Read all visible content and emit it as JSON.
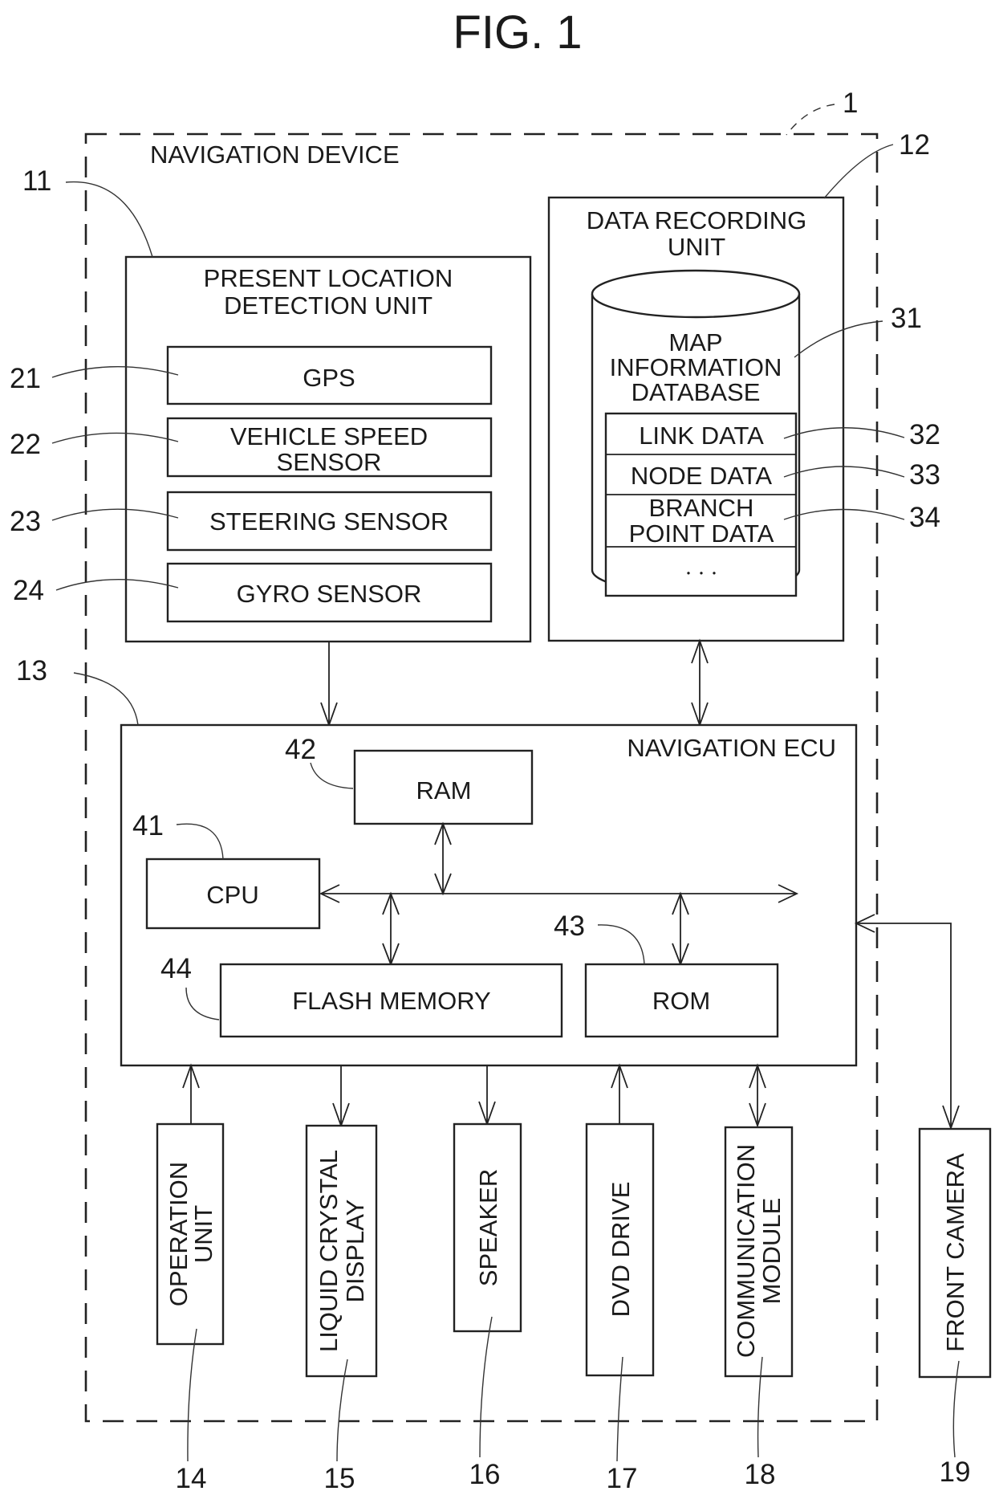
{
  "figure": {
    "title": "FIG. 1",
    "device_ref": "1",
    "device_label": "NAVIGATION DEVICE"
  },
  "present_location_unit": {
    "ref": "11",
    "title_line1": "PRESENT LOCATION",
    "title_line2": "DETECTION UNIT",
    "sensors": [
      {
        "ref": "21",
        "line1": "GPS",
        "line2": ""
      },
      {
        "ref": "22",
        "line1": "VEHICLE SPEED",
        "line2": "SENSOR"
      },
      {
        "ref": "23",
        "line1": "STEERING SENSOR",
        "line2": ""
      },
      {
        "ref": "24",
        "line1": "GYRO SENSOR",
        "line2": ""
      }
    ]
  },
  "data_recording_unit": {
    "ref": "12",
    "title_line1": "DATA RECORDING",
    "title_line2": "UNIT",
    "database": {
      "ref": "31",
      "line1": "MAP",
      "line2": "INFORMATION",
      "line3": "DATABASE",
      "rows": [
        {
          "ref": "32",
          "line1": "LINK DATA",
          "line2": ""
        },
        {
          "ref": "33",
          "line1": "NODE DATA",
          "line2": ""
        },
        {
          "ref": "34",
          "line1": "BRANCH",
          "line2": "POINT DATA"
        },
        {
          "ref": "",
          "line1": "・・・",
          "line2": ""
        }
      ]
    }
  },
  "navigation_ecu": {
    "ref": "13",
    "label": "NAVIGATION ECU",
    "cpu": {
      "ref": "41",
      "label": "CPU"
    },
    "ram": {
      "ref": "42",
      "label": "RAM"
    },
    "rom": {
      "ref": "43",
      "label": "ROM"
    },
    "flash": {
      "ref": "44",
      "label": "FLASH MEMORY"
    }
  },
  "peripherals": [
    {
      "ref": "14",
      "line1": "OPERATION",
      "line2": "UNIT"
    },
    {
      "ref": "15",
      "line1": "LIQUID CRYSTAL",
      "line2": "DISPLAY"
    },
    {
      "ref": "16",
      "line1": "SPEAKER",
      "line2": ""
    },
    {
      "ref": "17",
      "line1": "DVD DRIVE",
      "line2": ""
    },
    {
      "ref": "18",
      "line1": "COMMUNICATION",
      "line2": "MODULE"
    },
    {
      "ref": "19",
      "line1": "FRONT CAMERA",
      "line2": ""
    }
  ]
}
